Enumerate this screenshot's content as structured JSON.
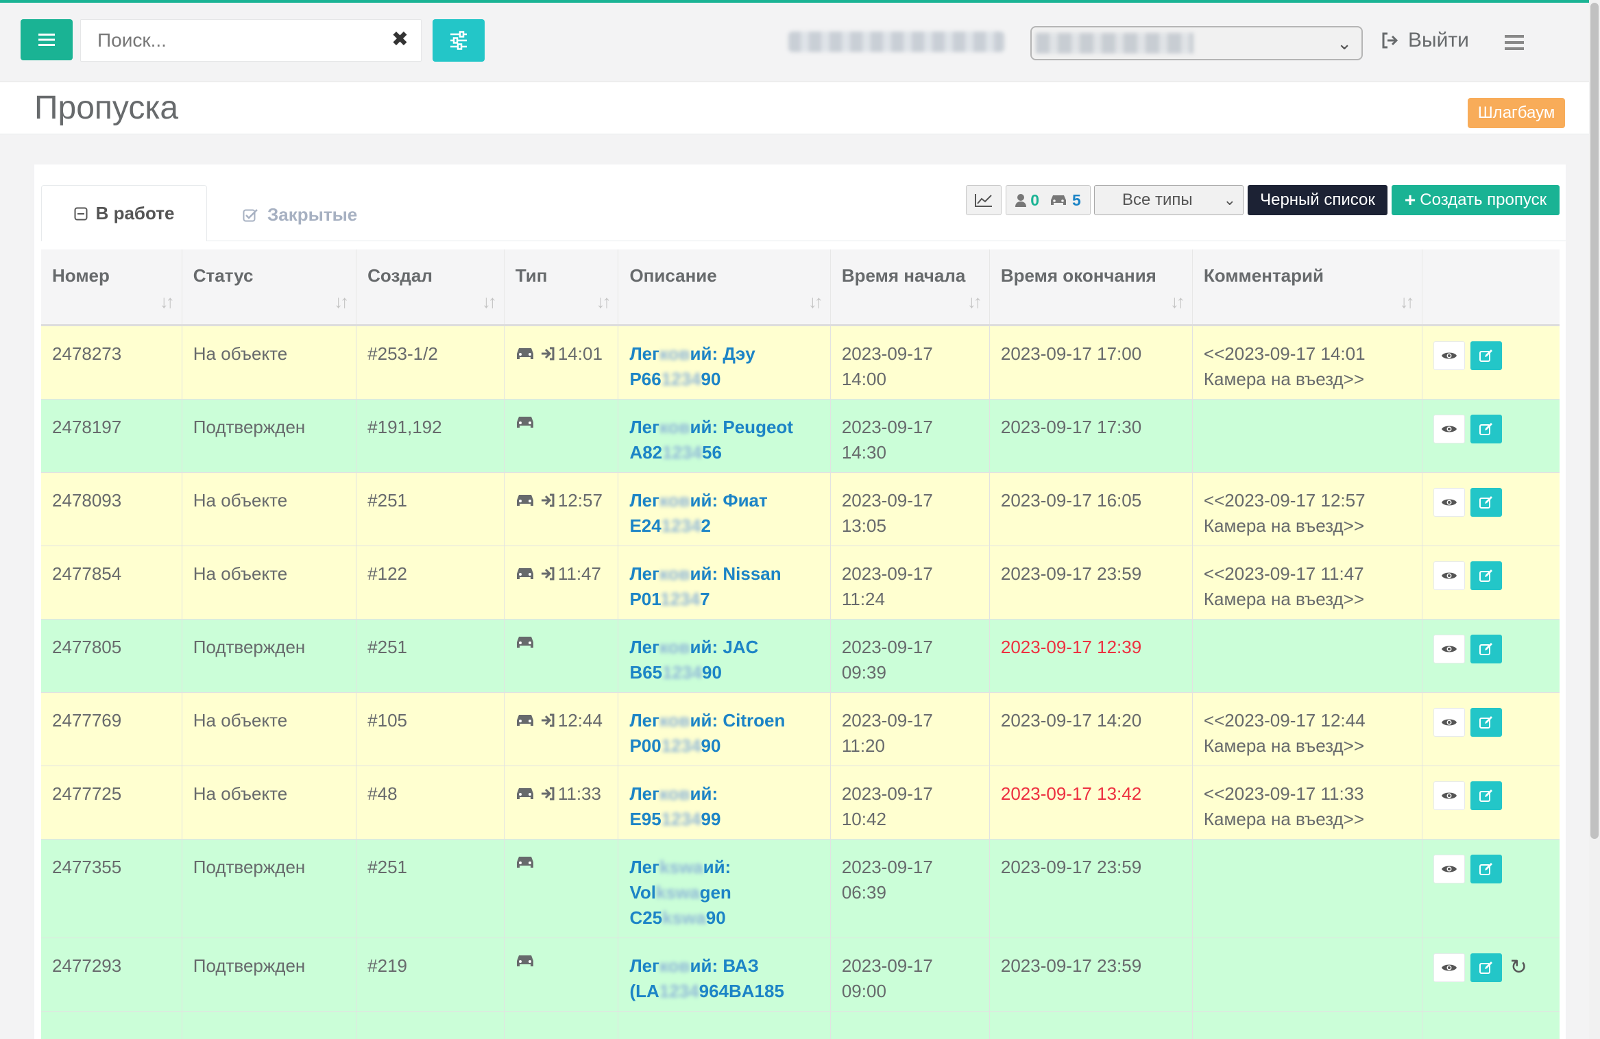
{
  "header": {
    "search_placeholder": "Поиск...",
    "logout_label": "Выйти"
  },
  "page": {
    "title": "Пропуска",
    "barrier_button": "Шлагбаум"
  },
  "tabs": [
    {
      "label": "В работе",
      "active": true
    },
    {
      "label": "Закрытые",
      "active": false
    }
  ],
  "toolbar": {
    "people_count": "0",
    "cars_count": "5",
    "type_filter": "Все типы",
    "blacklist_label": "Черный список",
    "create_label": "Создать пропуск"
  },
  "colors": {
    "accent": "#1ab394",
    "info": "#23c6c8",
    "warning": "#f8ac59",
    "row_on_site": "#ffffd0",
    "row_confirmed": "#cbfed8",
    "link": "#1c84c6",
    "overdue": "#ed3040"
  },
  "table": {
    "columns": [
      "Номер",
      "Статус",
      "Создал",
      "Тип",
      "Описание",
      "Время начала",
      "Время окончания",
      "Комментарий"
    ],
    "rows": [
      {
        "number": "2478273",
        "status": "На объекте",
        "creator": "#253-1/2",
        "entry_time": "14:01",
        "desc_a": "Лег",
        "desc_b": "ий: Дэу",
        "desc_c": "Р66",
        "desc_d": "90",
        "start": "2023-09-17 14:00",
        "end": "2023-09-17 17:00",
        "end_overdue": false,
        "comment_1": "<<2023-09-17 14:01",
        "comment_2": "Камера на въезд>>",
        "color": "yellow"
      },
      {
        "number": "2478197",
        "status": "Подтвержден",
        "creator": "#191,192",
        "entry_time": "",
        "desc_a": "Лег",
        "desc_b": "ий: Peugeot",
        "desc_c": "А82",
        "desc_d": "56",
        "start": "2023-09-17 14:30",
        "end": "2023-09-17 17:30",
        "end_overdue": false,
        "comment_1": "",
        "comment_2": "",
        "color": "green"
      },
      {
        "number": "2478093",
        "status": "На объекте",
        "creator": "#251",
        "entry_time": "12:57",
        "desc_a": "Лег",
        "desc_b": "ий: Фиат",
        "desc_c": "Е24",
        "desc_d": "2",
        "start": "2023-09-17 13:05",
        "end": "2023-09-17 16:05",
        "end_overdue": false,
        "comment_1": "<<2023-09-17 12:57",
        "comment_2": "Камера на въезд>>",
        "color": "yellow"
      },
      {
        "number": "2477854",
        "status": "На объекте",
        "creator": "#122",
        "entry_time": "11:47",
        "desc_a": "Лег",
        "desc_b": "ий: Nissan",
        "desc_c": "Р01",
        "desc_d": "7",
        "start": "2023-09-17 11:24",
        "end": "2023-09-17 23:59",
        "end_overdue": false,
        "comment_1": "<<2023-09-17 11:47",
        "comment_2": "Камера на въезд>>",
        "color": "yellow"
      },
      {
        "number": "2477805",
        "status": "Подтвержден",
        "creator": "#251",
        "entry_time": "",
        "desc_a": "Лег",
        "desc_b": "ий: JAC",
        "desc_c": "В65",
        "desc_d": "90",
        "start": "2023-09-17 09:39",
        "end": "2023-09-17 12:39",
        "end_overdue": true,
        "comment_1": "",
        "comment_2": "",
        "color": "green"
      },
      {
        "number": "2477769",
        "status": "На объекте",
        "creator": "#105",
        "entry_time": "12:44",
        "desc_a": "Лег",
        "desc_b": "ий: Citroen",
        "desc_c": "Р00",
        "desc_d": "90",
        "start": "2023-09-17 11:20",
        "end": "2023-09-17 14:20",
        "end_overdue": false,
        "comment_1": "<<2023-09-17 12:44",
        "comment_2": "Камера на въезд>>",
        "color": "yellow"
      },
      {
        "number": "2477725",
        "status": "На объекте",
        "creator": "#48",
        "entry_time": "11:33",
        "desc_a": "Лег",
        "desc_b": "ий:",
        "desc_c": "Е95",
        "desc_d": "99",
        "start": "2023-09-17 10:42",
        "end": "2023-09-17 13:42",
        "end_overdue": true,
        "comment_1": "<<2023-09-17 11:33",
        "comment_2": "Камера на въезд>>",
        "color": "yellow"
      }
    ],
    "row8": {
      "number": "2477355",
      "status": "Подтвержден",
      "creator": "#251",
      "desc_a": "Лег",
      "desc_b": "ий:",
      "desc_c": "Vol",
      "desc_d": "gen",
      "desc_e": "С25",
      "desc_f": "90",
      "start": "2023-09-17 06:39",
      "end": "2023-09-17 23:59"
    },
    "row9": {
      "number": "2477293",
      "status": "Подтвержден",
      "creator": "#219",
      "desc_a": "Лег",
      "desc_b": "ий: ВАЗ",
      "desc_c": "(LA",
      "desc_d": "964BA185",
      "start": "2023-09-17 09:00",
      "end": "2023-09-17 23:59"
    }
  }
}
